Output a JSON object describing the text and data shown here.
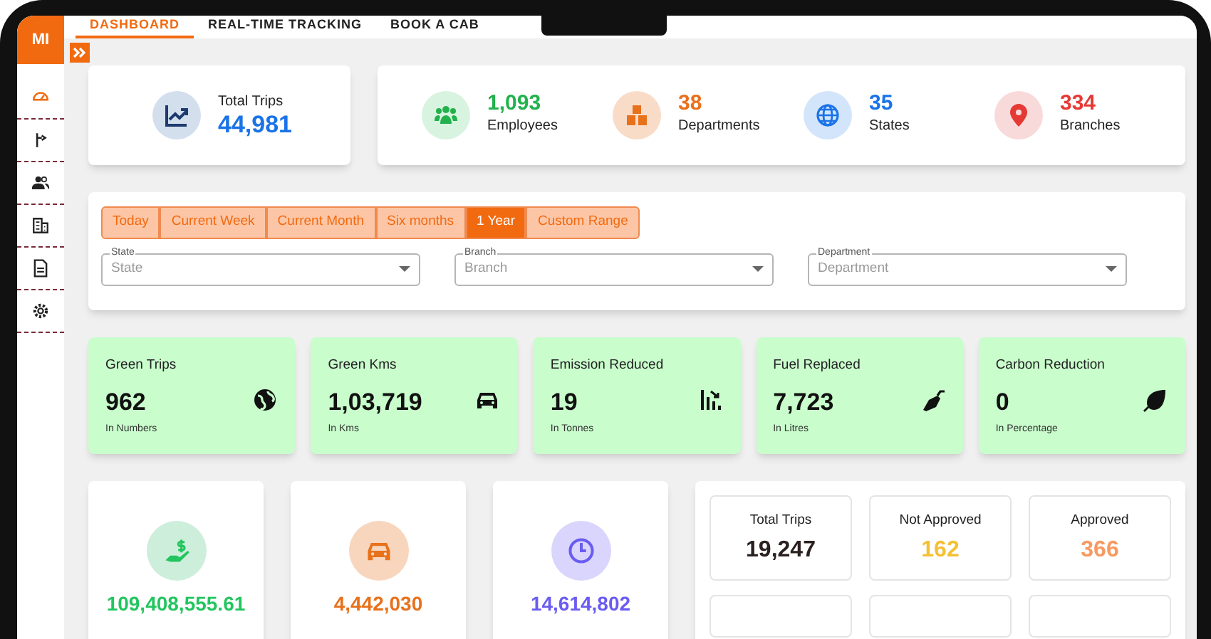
{
  "brand": {
    "logo": "MI"
  },
  "nav": [
    {
      "label": "DASHBOARD",
      "selected": true
    },
    {
      "label": "REAL-TIME TRACKING",
      "selected": false
    },
    {
      "label": "BOOK A CAB",
      "selected": false
    }
  ],
  "sidebar": {
    "items": [
      {
        "selected": true
      },
      {
        "selected": false
      },
      {
        "selected": false
      },
      {
        "selected": false
      },
      {
        "selected": false
      },
      {
        "selected": false
      }
    ]
  },
  "total_trips": {
    "label": "Total Trips",
    "value": "44,981",
    "color": "#1a73e8"
  },
  "summary": [
    {
      "value": "1,093",
      "label": "Employees",
      "color": "#22b14c"
    },
    {
      "value": "38",
      "label": "Departments",
      "color": "#e8711c"
    },
    {
      "value": "35",
      "label": "States",
      "color": "#1a73e8"
    },
    {
      "value": "334",
      "label": "Branches",
      "color": "#e53935"
    }
  ],
  "ranges": [
    {
      "label": "Today",
      "selected": false
    },
    {
      "label": "Current Week",
      "selected": false
    },
    {
      "label": "Current Month",
      "selected": false
    },
    {
      "label": "Six months",
      "selected": false
    },
    {
      "label": "1 Year",
      "selected": true
    },
    {
      "label": "Custom Range",
      "selected": false
    }
  ],
  "filters": [
    {
      "label": "State",
      "placeholder": "State"
    },
    {
      "label": "Branch",
      "placeholder": "Branch"
    },
    {
      "label": "Department",
      "placeholder": "Department"
    }
  ],
  "green_stats": [
    {
      "title": "Green Trips",
      "value": "962",
      "unit": "In Numbers"
    },
    {
      "title": "Green Kms",
      "value": "1,03,719",
      "unit": "In Kms"
    },
    {
      "title": "Emission Reduced",
      "value": "19",
      "unit": "In Tonnes"
    },
    {
      "title": "Fuel Replaced",
      "value": "7,723",
      "unit": "In Litres"
    },
    {
      "title": "Carbon Reduction",
      "value": "0",
      "unit": "In Percentage"
    }
  ],
  "totals": [
    {
      "value": "109,408,555.61",
      "color": "#22c55e"
    },
    {
      "value": "4,442,030",
      "color": "#e8711c"
    },
    {
      "value": "14,614,802",
      "color": "#6a5cf0"
    }
  ],
  "trip_status": [
    {
      "label": "Total Trips",
      "value": "19,247",
      "color": "#2a2020"
    },
    {
      "label": "Not Approved",
      "value": "162",
      "color": "#f5c033"
    },
    {
      "label": "Approved",
      "value": "366",
      "color": "#f79a62"
    }
  ]
}
